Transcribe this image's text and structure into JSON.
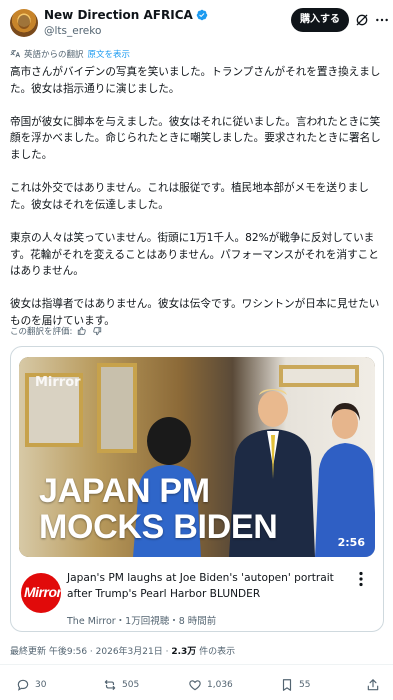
{
  "author": {
    "name": "New Direction AFRICA",
    "handle": "@lts_ereko",
    "subscribe_label": "購入する"
  },
  "translation": {
    "note": "英語からの翻訳",
    "show_original": "原文を表示",
    "rate": "この翻訳を評価:"
  },
  "tweet": {
    "paragraphs": [
      "高市さんがバイデンの写真を笑いました。トランプさんがそれを置き換えました。彼女は指示通りに演じました。",
      "帝国が彼女に脚本を与えました。彼女はそれに従いました。言われたときに笑顔を浮かべました。命じられたときに嘲笑しました。要求されたときに署名しました。",
      "これは外交ではありません。これは服従です。植民地本部がメモを送りました。彼女はそれを伝達しました。",
      "東京の人々は笑っていません。街頭に1万1千人。82%が戦争に反対しています。花輪がそれを変えることはありません。パフォーマンスがそれを消すことはありません。",
      "彼女は指導者ではありません。彼女は伝令です。ワシントンが日本に見せたいものを届けています。"
    ]
  },
  "card": {
    "watermark": "Mirror",
    "headline_line1": "JAPAN PM",
    "headline_line2": "MOCKS BIDEN",
    "duration": "2:56",
    "channel_logo_text": "Mirror",
    "video_title": "Japan's PM laughs at Joe Biden's 'autopen' portrait after Trump's Pearl Harbor BLUNDER",
    "video_meta": "The Mirror・1万回視聴・8 時間前"
  },
  "meta": {
    "timestamp_prefix": "最終更新 午後9:56 · 2026年3月21日 · ",
    "views": "2.3万",
    "views_suffix": " 件の表示"
  },
  "actions": {
    "replies": "30",
    "reposts": "505",
    "likes": "1,036",
    "bookmarks": "55"
  },
  "colors": {
    "accent": "#1d9bf0",
    "verified": "#1d9bf0",
    "mirror_red": "#e10a0a"
  }
}
